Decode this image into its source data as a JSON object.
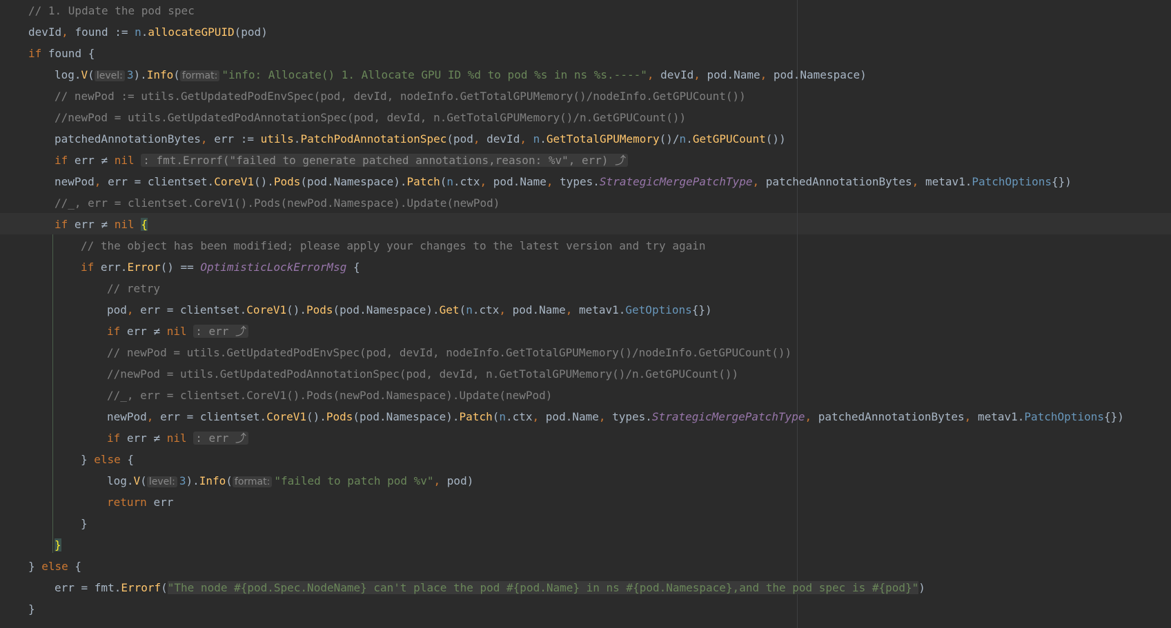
{
  "lines": [
    {
      "i": 0,
      "tokens": [
        {
          "c": "cm",
          "t": "// 1. Update the pod spec"
        }
      ]
    },
    {
      "i": 1,
      "tokens": [
        {
          "c": "plain",
          "t": "devId"
        },
        {
          "c": "kw",
          "t": ", "
        },
        {
          "c": "plain",
          "t": "found := "
        },
        {
          "c": "type",
          "t": "n"
        },
        {
          "c": "plain",
          "t": "."
        },
        {
          "c": "fn",
          "t": "allocateGPUID"
        },
        {
          "c": "plain",
          "t": "(pod)"
        }
      ]
    },
    {
      "i": 1,
      "tokens": [
        {
          "c": "kw",
          "t": "if "
        },
        {
          "c": "plain",
          "t": "found {"
        }
      ]
    },
    {
      "i": 2,
      "tokens": [
        {
          "c": "plain",
          "t": "log."
        },
        {
          "c": "fn",
          "t": "V"
        },
        {
          "c": "plain",
          "t": "("
        },
        {
          "c": "hint",
          "t": "level:"
        },
        {
          "c": "num",
          "t": "3"
        },
        {
          "c": "plain",
          "t": ")."
        },
        {
          "c": "fn",
          "t": "Info"
        },
        {
          "c": "plain",
          "t": "("
        },
        {
          "c": "hint",
          "t": "format:"
        },
        {
          "c": "str",
          "t": "\"info: Allocate() 1. Allocate GPU ID %d to pod %s in ns %s.----\""
        },
        {
          "c": "kw",
          "t": ", "
        },
        {
          "c": "plain",
          "t": "devId"
        },
        {
          "c": "kw",
          "t": ", "
        },
        {
          "c": "plain",
          "t": "pod.Name"
        },
        {
          "c": "kw",
          "t": ", "
        },
        {
          "c": "plain",
          "t": "pod.Namespace)"
        }
      ]
    },
    {
      "i": 2,
      "tokens": [
        {
          "c": "cm",
          "t": "// newPod := utils.GetUpdatedPodEnvSpec(pod, devId, nodeInfo.GetTotalGPUMemory()/nodeInfo.GetGPUCount())"
        }
      ]
    },
    {
      "i": 2,
      "tokens": [
        {
          "c": "cm",
          "t": "//newPod = utils.GetUpdatedPodAnnotationSpec(pod, devId, n.GetTotalGPUMemory()/n.GetGPUCount())"
        }
      ]
    },
    {
      "i": 2,
      "tokens": [
        {
          "c": "plain",
          "t": "patchedAnnotationBytes"
        },
        {
          "c": "kw",
          "t": ", "
        },
        {
          "c": "plain",
          "t": "err := "
        },
        {
          "c": "fn",
          "t": "utils"
        },
        {
          "c": "plain",
          "t": "."
        },
        {
          "c": "fn",
          "t": "PatchPodAnnotationSpec"
        },
        {
          "c": "plain",
          "t": "(pod"
        },
        {
          "c": "kw",
          "t": ", "
        },
        {
          "c": "plain",
          "t": "devId"
        },
        {
          "c": "kw",
          "t": ", "
        },
        {
          "c": "type",
          "t": "n"
        },
        {
          "c": "plain",
          "t": "."
        },
        {
          "c": "fn",
          "t": "GetTotalGPUMemory"
        },
        {
          "c": "plain",
          "t": "()/"
        },
        {
          "c": "type",
          "t": "n"
        },
        {
          "c": "plain",
          "t": "."
        },
        {
          "c": "fn",
          "t": "GetGPUCount"
        },
        {
          "c": "plain",
          "t": "())"
        }
      ]
    },
    {
      "i": 2,
      "tokens": [
        {
          "c": "kw",
          "t": "if "
        },
        {
          "c": "plain",
          "t": "err ≠ "
        },
        {
          "c": "kw",
          "t": "nil "
        },
        {
          "c": "fold",
          "t": ": fmt.Errorf(\"failed to generate patched annotations,reason: %v\", err) ⤴"
        }
      ]
    },
    {
      "i": 2,
      "tokens": [
        {
          "c": "plain",
          "t": "newPod"
        },
        {
          "c": "kw",
          "t": ", "
        },
        {
          "c": "plain",
          "t": "err = clientset."
        },
        {
          "c": "fn",
          "t": "CoreV1"
        },
        {
          "c": "plain",
          "t": "()."
        },
        {
          "c": "fn",
          "t": "Pods"
        },
        {
          "c": "plain",
          "t": "(pod.Namespace)."
        },
        {
          "c": "fn",
          "t": "Patch"
        },
        {
          "c": "plain",
          "t": "("
        },
        {
          "c": "type",
          "t": "n"
        },
        {
          "c": "plain",
          "t": ".ctx"
        },
        {
          "c": "kw",
          "t": ", "
        },
        {
          "c": "plain",
          "t": "pod.Name"
        },
        {
          "c": "kw",
          "t": ", "
        },
        {
          "c": "plain",
          "t": "types."
        },
        {
          "c": "var",
          "t": "StrategicMergePatchType"
        },
        {
          "c": "kw",
          "t": ", "
        },
        {
          "c": "plain",
          "t": "patchedAnnotationBytes"
        },
        {
          "c": "kw",
          "t": ", "
        },
        {
          "c": "plain",
          "t": "metav1."
        },
        {
          "c": "type",
          "t": "PatchOptions"
        },
        {
          "c": "plain",
          "t": "{})"
        }
      ]
    },
    {
      "i": 2,
      "tokens": [
        {
          "c": "cm",
          "t": "//_, err = clientset.CoreV1().Pods(newPod.Namespace).Update(newPod)"
        }
      ]
    },
    {
      "i": 2,
      "tokens": [
        {
          "c": "kw",
          "t": "if "
        },
        {
          "c": "plain",
          "t": "err ≠ "
        },
        {
          "c": "kw",
          "t": "nil "
        },
        {
          "c": "match",
          "t": "{"
        }
      ]
    },
    {
      "i": 3,
      "tokens": [
        {
          "c": "cm",
          "t": "// the object has been modified; please apply your changes to the latest version and try again"
        }
      ]
    },
    {
      "i": 3,
      "tokens": [
        {
          "c": "kw",
          "t": "if "
        },
        {
          "c": "plain",
          "t": "err."
        },
        {
          "c": "fn",
          "t": "Error"
        },
        {
          "c": "plain",
          "t": "() == "
        },
        {
          "c": "var",
          "t": "OptimisticLockErrorMsg"
        },
        {
          "c": "plain",
          "t": " {"
        }
      ]
    },
    {
      "i": 4,
      "tokens": [
        {
          "c": "cm",
          "t": "// retry"
        }
      ]
    },
    {
      "i": 4,
      "tokens": [
        {
          "c": "plain",
          "t": "pod"
        },
        {
          "c": "kw",
          "t": ", "
        },
        {
          "c": "plain",
          "t": "err = clientset."
        },
        {
          "c": "fn",
          "t": "CoreV1"
        },
        {
          "c": "plain",
          "t": "()."
        },
        {
          "c": "fn",
          "t": "Pods"
        },
        {
          "c": "plain",
          "t": "(pod.Namespace)."
        },
        {
          "c": "fn",
          "t": "Get"
        },
        {
          "c": "plain",
          "t": "("
        },
        {
          "c": "type",
          "t": "n"
        },
        {
          "c": "plain",
          "t": ".ctx"
        },
        {
          "c": "kw",
          "t": ", "
        },
        {
          "c": "plain",
          "t": "pod.Name"
        },
        {
          "c": "kw",
          "t": ", "
        },
        {
          "c": "plain",
          "t": "metav1."
        },
        {
          "c": "type",
          "t": "GetOptions"
        },
        {
          "c": "plain",
          "t": "{})"
        }
      ]
    },
    {
      "i": 4,
      "tokens": [
        {
          "c": "kw",
          "t": "if "
        },
        {
          "c": "plain",
          "t": "err ≠ "
        },
        {
          "c": "kw",
          "t": "nil "
        },
        {
          "c": "fold",
          "t": ": err ⤴"
        }
      ]
    },
    {
      "i": 4,
      "tokens": [
        {
          "c": "cm",
          "t": "// newPod = utils.GetUpdatedPodEnvSpec(pod, devId, nodeInfo.GetTotalGPUMemory()/nodeInfo.GetGPUCount())"
        }
      ]
    },
    {
      "i": 4,
      "tokens": [
        {
          "c": "cm",
          "t": "//newPod = utils.GetUpdatedPodAnnotationSpec(pod, devId, n.GetTotalGPUMemory()/n.GetGPUCount())"
        }
      ]
    },
    {
      "i": 4,
      "tokens": [
        {
          "c": "cm",
          "t": "//_, err = clientset.CoreV1().Pods(newPod.Namespace).Update(newPod)"
        }
      ]
    },
    {
      "i": 4,
      "tokens": [
        {
          "c": "plain",
          "t": "newPod"
        },
        {
          "c": "kw",
          "t": ", "
        },
        {
          "c": "plain",
          "t": "err = clientset."
        },
        {
          "c": "fn",
          "t": "CoreV1"
        },
        {
          "c": "plain",
          "t": "()."
        },
        {
          "c": "fn",
          "t": "Pods"
        },
        {
          "c": "plain",
          "t": "(pod.Namespace)."
        },
        {
          "c": "fn",
          "t": "Patch"
        },
        {
          "c": "plain",
          "t": "("
        },
        {
          "c": "type",
          "t": "n"
        },
        {
          "c": "plain",
          "t": ".ctx"
        },
        {
          "c": "kw",
          "t": ", "
        },
        {
          "c": "plain",
          "t": "pod.Name"
        },
        {
          "c": "kw",
          "t": ", "
        },
        {
          "c": "plain",
          "t": "types."
        },
        {
          "c": "var",
          "t": "StrategicMergePatchType"
        },
        {
          "c": "kw",
          "t": ", "
        },
        {
          "c": "plain",
          "t": "patchedAnnotationBytes"
        },
        {
          "c": "kw",
          "t": ", "
        },
        {
          "c": "plain",
          "t": "metav1."
        },
        {
          "c": "type",
          "t": "PatchOptions"
        },
        {
          "c": "plain",
          "t": "{})"
        }
      ]
    },
    {
      "i": 4,
      "tokens": [
        {
          "c": "kw",
          "t": "if "
        },
        {
          "c": "plain",
          "t": "err ≠ "
        },
        {
          "c": "kw",
          "t": "nil "
        },
        {
          "c": "fold",
          "t": ": err ⤴"
        }
      ]
    },
    {
      "i": 3,
      "tokens": [
        {
          "c": "plain",
          "t": "} "
        },
        {
          "c": "kw",
          "t": "else"
        },
        {
          "c": "plain",
          "t": " {"
        }
      ]
    },
    {
      "i": 4,
      "tokens": [
        {
          "c": "plain",
          "t": "log."
        },
        {
          "c": "fn",
          "t": "V"
        },
        {
          "c": "plain",
          "t": "("
        },
        {
          "c": "hint",
          "t": "level:"
        },
        {
          "c": "num",
          "t": "3"
        },
        {
          "c": "plain",
          "t": ")."
        },
        {
          "c": "fn",
          "t": "Info"
        },
        {
          "c": "plain",
          "t": "("
        },
        {
          "c": "hint",
          "t": "format:"
        },
        {
          "c": "str",
          "t": "\"failed to patch pod %v\""
        },
        {
          "c": "kw",
          "t": ", "
        },
        {
          "c": "plain",
          "t": "pod)"
        }
      ]
    },
    {
      "i": 4,
      "tokens": [
        {
          "c": "kw",
          "t": "return "
        },
        {
          "c": "plain",
          "t": "err"
        }
      ]
    },
    {
      "i": 3,
      "tokens": [
        {
          "c": "plain",
          "t": "}"
        }
      ]
    },
    {
      "i": 2,
      "tokens": [
        {
          "c": "match",
          "t": "}"
        }
      ]
    },
    {
      "i": 1,
      "tokens": [
        {
          "c": "plain",
          "t": "} "
        },
        {
          "c": "kw",
          "t": "else"
        },
        {
          "c": "plain",
          "t": " {"
        }
      ]
    },
    {
      "i": 2,
      "tokens": [
        {
          "c": "plain",
          "t": "err = fmt."
        },
        {
          "c": "fn",
          "t": "Errorf"
        },
        {
          "c": "plain",
          "t": "("
        },
        {
          "c": "tmplstr",
          "t": "\"The node #{pod.Spec.NodeName} can't place the pod #{pod.Name} in ns #{pod.Namespace},and the pod spec is #{pod}\""
        },
        {
          "c": "plain",
          "t": ")"
        }
      ]
    },
    {
      "i": 1,
      "tokens": [
        {
          "c": "plain",
          "t": "}"
        }
      ]
    }
  ]
}
